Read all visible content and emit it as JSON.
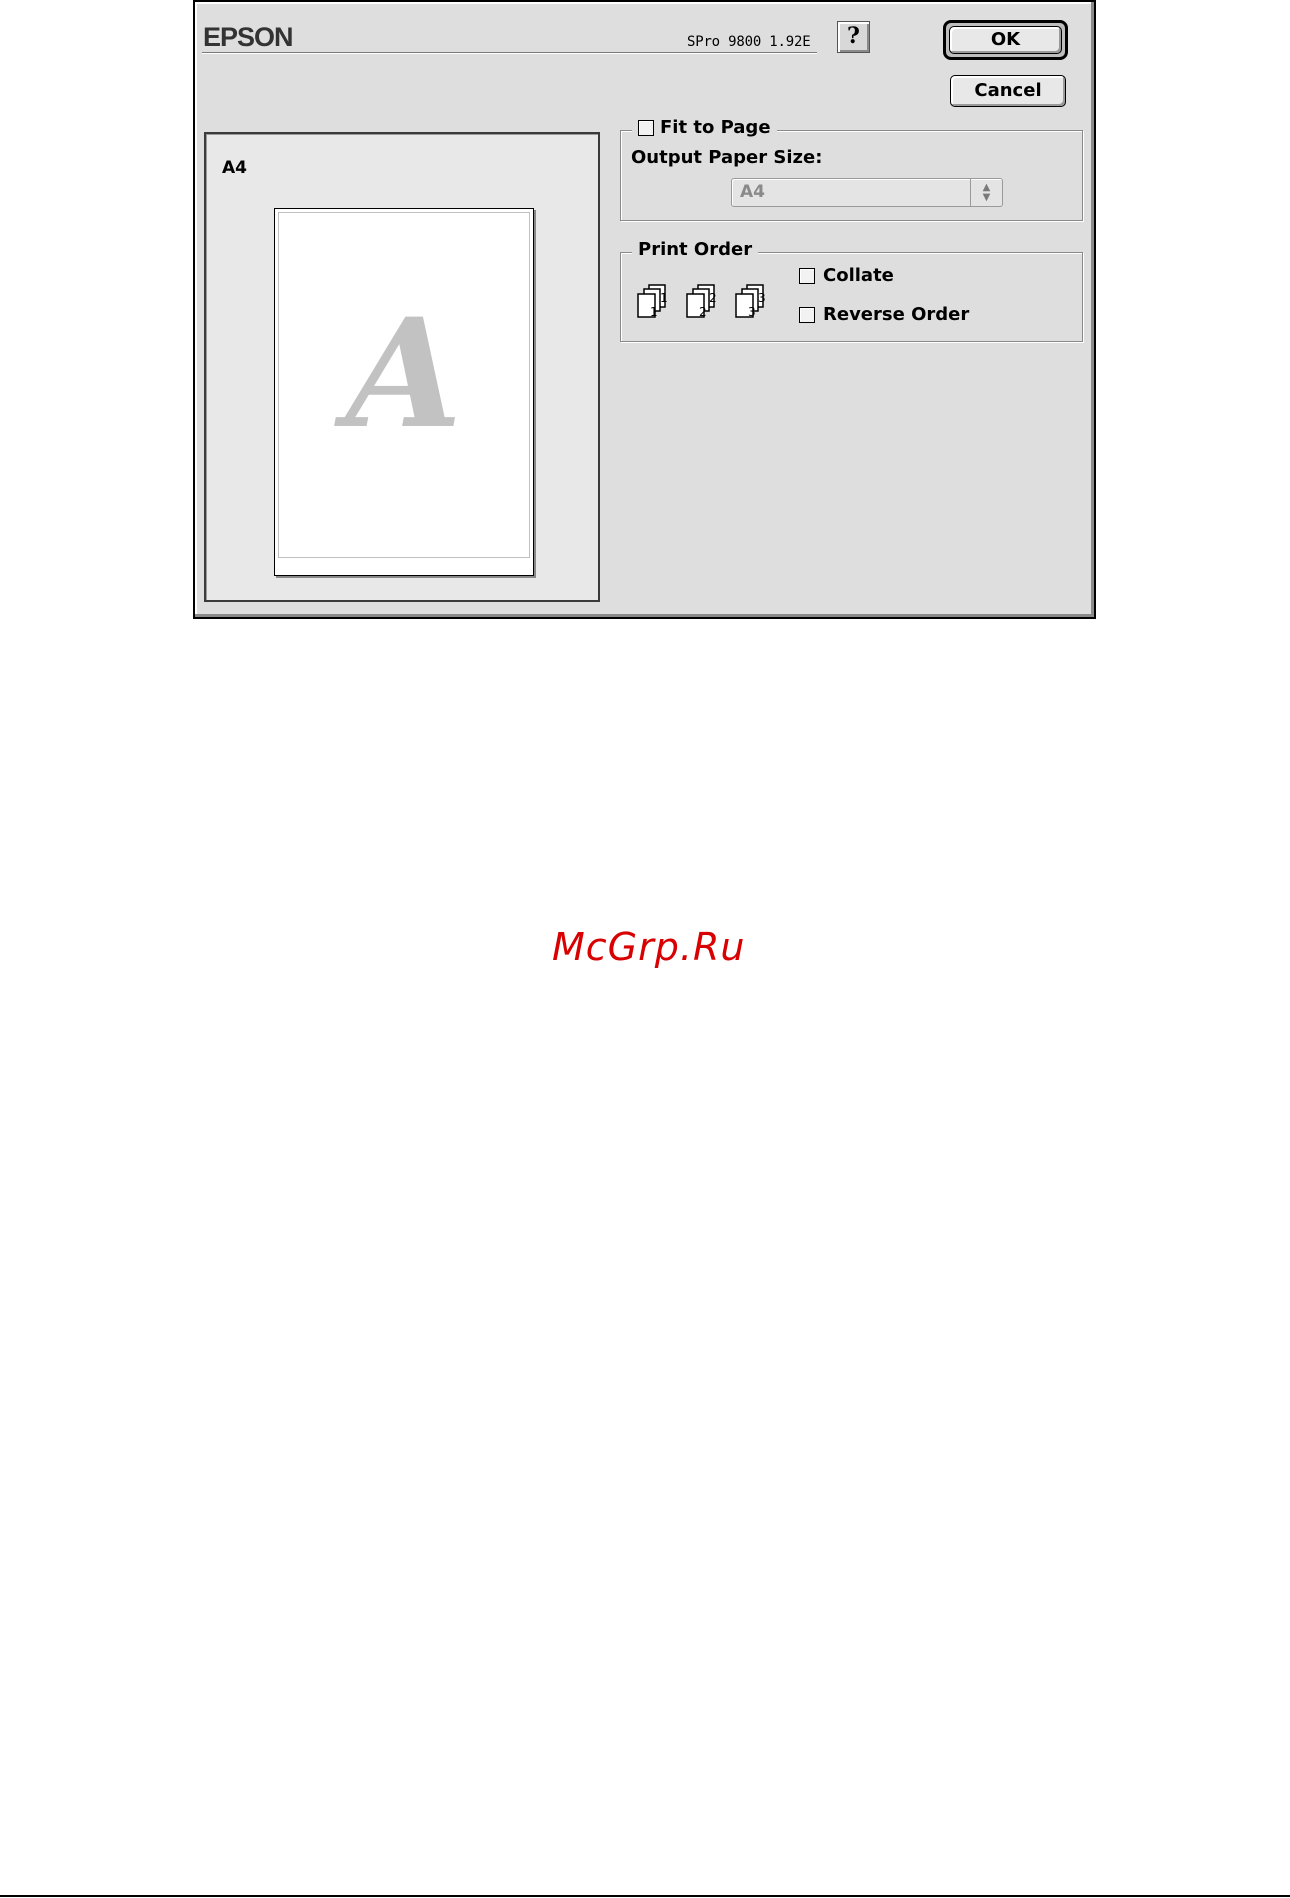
{
  "header": {
    "logo": "EPSON",
    "version": "SPro 9800 1.92E",
    "help_label": "?"
  },
  "buttons": {
    "ok": "OK",
    "cancel": "Cancel"
  },
  "preview": {
    "paper_size": "A4",
    "sample_letter": "A"
  },
  "fit_to_page": {
    "label": "Fit to Page",
    "checked": false,
    "output_paper_size_label": "Output Paper Size:",
    "output_paper_size_value": "A4",
    "select_arrows": "▲▼"
  },
  "print_order": {
    "label": "Print Order",
    "icons": [
      {
        "name": "order-1-icon",
        "number": "1"
      },
      {
        "name": "order-2-icon",
        "number": "2"
      },
      {
        "name": "order-3-icon",
        "number": "3"
      }
    ],
    "collate_label": "Collate",
    "collate_checked": false,
    "reverse_order_label": "Reverse Order",
    "reverse_order_checked": false
  },
  "watermark": "McGrp.Ru"
}
